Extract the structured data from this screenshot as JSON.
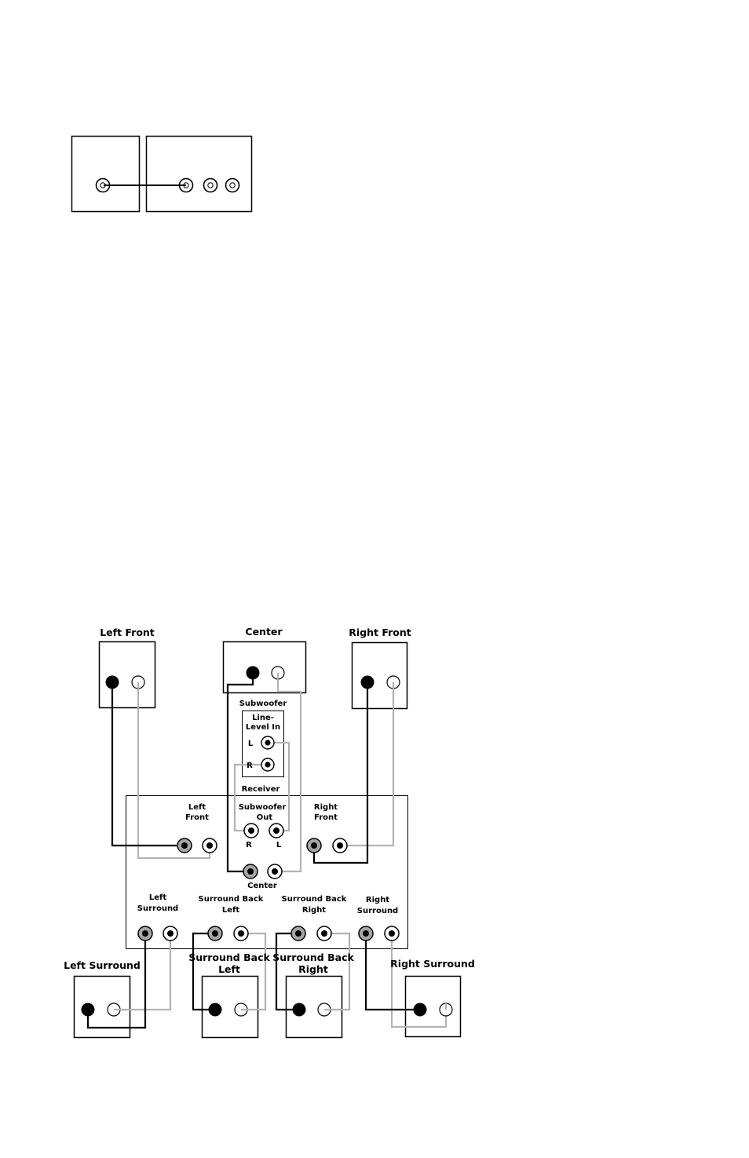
{
  "top_diagram": {
    "description": "Simple connection: single jack to first of three jacks",
    "left_box_jacks": 1,
    "right_box_jacks": 3
  },
  "speakers": {
    "left_front": "Left Front",
    "center": "Center",
    "right_front": "Right Front",
    "left_surround": "Left Surround",
    "surround_back_left": [
      "Surround Back",
      "Left"
    ],
    "surround_back_right": [
      "Surround Back",
      "Right"
    ],
    "right_surround": "Right Surround"
  },
  "subwoofer": {
    "title": "Subwoofer",
    "input_title": [
      "Line-",
      "Level In"
    ],
    "l": "L",
    "r": "R",
    "receiver": "Receiver"
  },
  "receiver": {
    "left_front": [
      "Left",
      "Front"
    ],
    "sub_out": [
      "Subwoofer",
      "Out"
    ],
    "sub_r": "R",
    "sub_l": "L",
    "right_front": [
      "Right",
      "Front"
    ],
    "center": "Center",
    "left_surround": [
      "Left",
      "Surround"
    ],
    "surround_back_left": [
      "Surround Back",
      "Left"
    ],
    "surround_back_right": [
      "Surround Back",
      "Right"
    ],
    "right_surround": [
      "Right",
      "Surround"
    ]
  },
  "colors": {
    "positive_wire": "#000000",
    "negative_wire": "#b3b3b3",
    "receiver_jack_fill": "#a6a6a6"
  }
}
